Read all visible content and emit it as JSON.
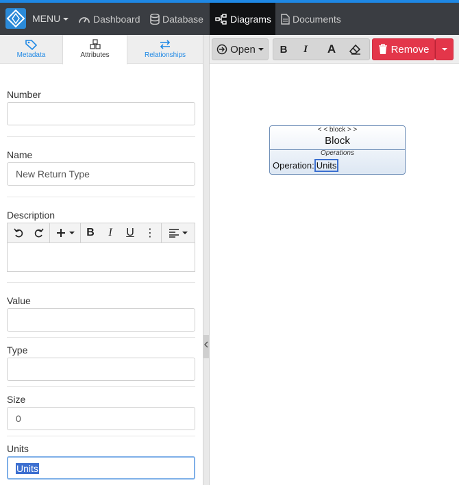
{
  "nav": {
    "menu_label": "MENU",
    "items": [
      {
        "label": "Dashboard",
        "icon": "gauge-icon"
      },
      {
        "label": "Database",
        "icon": "database-icon"
      },
      {
        "label": "Diagrams",
        "icon": "diagram-icon",
        "active": true
      },
      {
        "label": "Documents",
        "icon": "document-icon"
      }
    ]
  },
  "panel_tabs": [
    {
      "label": "Metadata",
      "icon": "tag-icon"
    },
    {
      "label": "Attributes",
      "icon": "cubes-icon",
      "active": true
    },
    {
      "label": "Relationships",
      "icon": "arrows-exchange-icon"
    }
  ],
  "fields": {
    "number": {
      "label": "Number",
      "value": ""
    },
    "name": {
      "label": "Name",
      "value": "New Return Type"
    },
    "description": {
      "label": "Description",
      "value": ""
    },
    "value": {
      "label": "Value",
      "value": ""
    },
    "type": {
      "label": "Type",
      "value": ""
    },
    "size": {
      "label": "Size",
      "value": "0"
    },
    "units": {
      "label": "Units",
      "value": "Units"
    }
  },
  "editor_toolbar": {
    "bold": "B",
    "italic": "I",
    "underline": "U",
    "more": "⋮"
  },
  "diagram_toolbar": {
    "open_label": "Open",
    "bold": "B",
    "italic": "I",
    "font": "A",
    "remove_label": "Remove"
  },
  "block": {
    "stereotype": "< < block > >",
    "name": "Block",
    "compartment": "Operations",
    "operation_label": "Operation:",
    "operation_value": "Units"
  },
  "colors": {
    "accent": "#1e88e5",
    "nav_bg": "#3a3d42",
    "remove": "#e3364a"
  }
}
